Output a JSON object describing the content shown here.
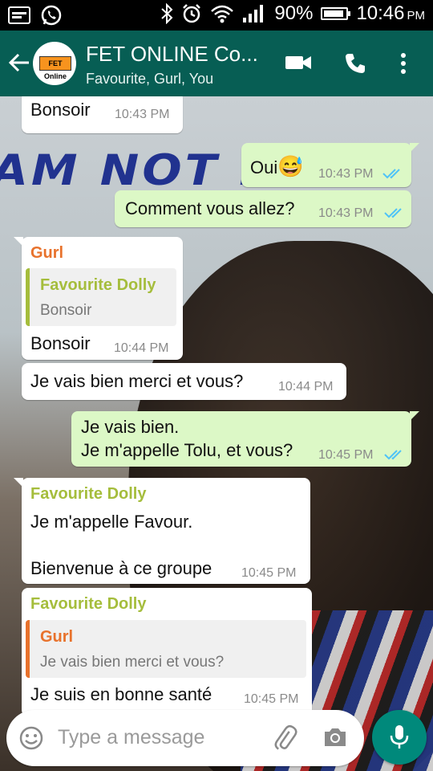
{
  "status_bar": {
    "battery": "90%",
    "time": "10:46",
    "ampm": "PM",
    "battery_level": 0.9
  },
  "header": {
    "title": "FET ONLINE Co...",
    "subtitle": "Favourite, Gurl, You",
    "avatar_logo": "FET Online"
  },
  "background_text": "AM NOT MY ...",
  "messages": [
    {
      "text": "Bonsoir",
      "time": "10:43 PM"
    },
    {
      "text": "Oui",
      "emoji": "😅",
      "time": "10:43 PM"
    },
    {
      "text": "Comment vous allez?",
      "time": "10:43 PM"
    },
    {
      "sender": "Gurl",
      "quote_name": "Favourite Dolly",
      "quote_text": "Bonsoir",
      "text": "Bonsoir",
      "time": "10:44 PM"
    },
    {
      "text": "Je vais bien merci et vous?",
      "time": "10:44 PM"
    },
    {
      "line1": "Je vais bien.",
      "line2": "Je m'appelle Tolu, et vous?",
      "time": "10:45 PM"
    },
    {
      "sender": "Favourite Dolly",
      "line1": "Je m'appelle Favour.",
      "line2": "Bienvenue à ce groupe",
      "time": "10:45 PM"
    },
    {
      "sender": "Favourite Dolly",
      "quote_name": "Gurl",
      "quote_text": "Je vais bien merci et vous?",
      "text": "Je suis en bonne santé",
      "time": "10:45 PM"
    }
  ],
  "input": {
    "placeholder": "Type a message"
  },
  "colors": {
    "header": "#075e54",
    "outgoing_bubble": "#dcf8c6",
    "incoming_bubble": "#ffffff",
    "sender_gurl": "#e8722c",
    "sender_favourite": "#a5bd3c",
    "read_ticks": "#4fc3f7",
    "mic_button": "#00897b"
  }
}
